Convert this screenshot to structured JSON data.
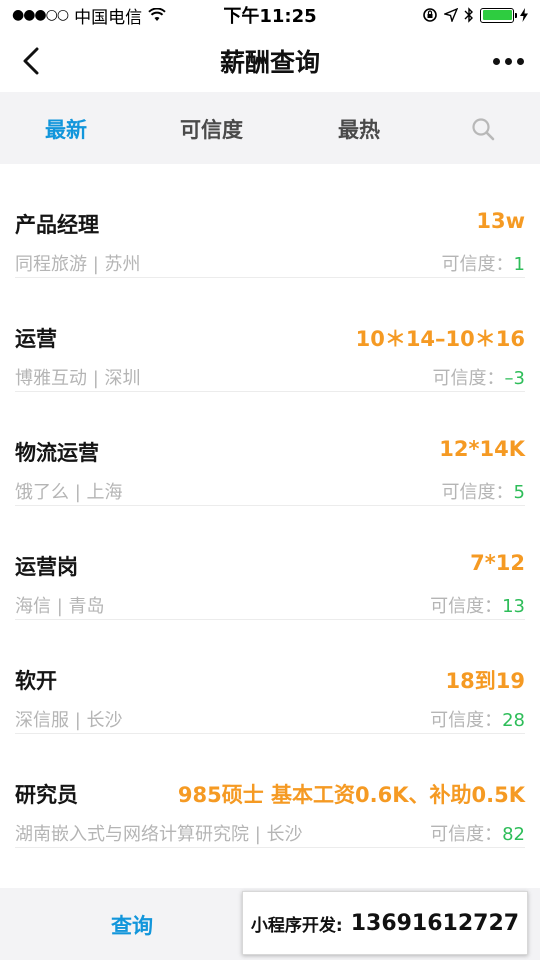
{
  "status_bar": {
    "signal": "●●●○○",
    "carrier": "中国电信",
    "time": "下午11:25"
  },
  "nav": {
    "title": "薪酬查询"
  },
  "tabs": [
    {
      "label": "最新",
      "active": true
    },
    {
      "label": "可信度",
      "active": false
    },
    {
      "label": "最热",
      "active": false
    }
  ],
  "items": [
    {
      "title": "产品经理",
      "salary": "13w",
      "company": "同程旅游 | 苏州",
      "cred_label": "可信度：",
      "cred_value": "1"
    },
    {
      "title": "运营",
      "salary": "10＊14–10＊16",
      "company": "博雅互动 | 深圳",
      "cred_label": "可信度：",
      "cred_value": "–3"
    },
    {
      "title": "物流运营",
      "salary": "12*14K",
      "company": "饿了么 | 上海",
      "cred_label": "可信度：",
      "cred_value": "5"
    },
    {
      "title": "运营岗",
      "salary": "7*12",
      "company": "海信 | 青岛",
      "cred_label": "可信度：",
      "cred_value": "13"
    },
    {
      "title": "软开",
      "salary": "18到19",
      "company": "深信服 | 长沙",
      "cred_label": "可信度：",
      "cred_value": "28"
    },
    {
      "title": "研究员",
      "salary": "985硕士 基本工资0.6K、补助0.5K",
      "company": "湖南嵌入式与网络计算研究院 | 长沙",
      "cred_label": "可信度：",
      "cred_value": "82"
    }
  ],
  "bottom": {
    "query_label": "查询"
  },
  "promo": {
    "label": "小程序开发:",
    "number": "13691612727"
  },
  "colors": {
    "accent": "#1296db",
    "salary": "#f59a23",
    "credibility": "#2ebd59",
    "battery": "#2ecc40"
  }
}
